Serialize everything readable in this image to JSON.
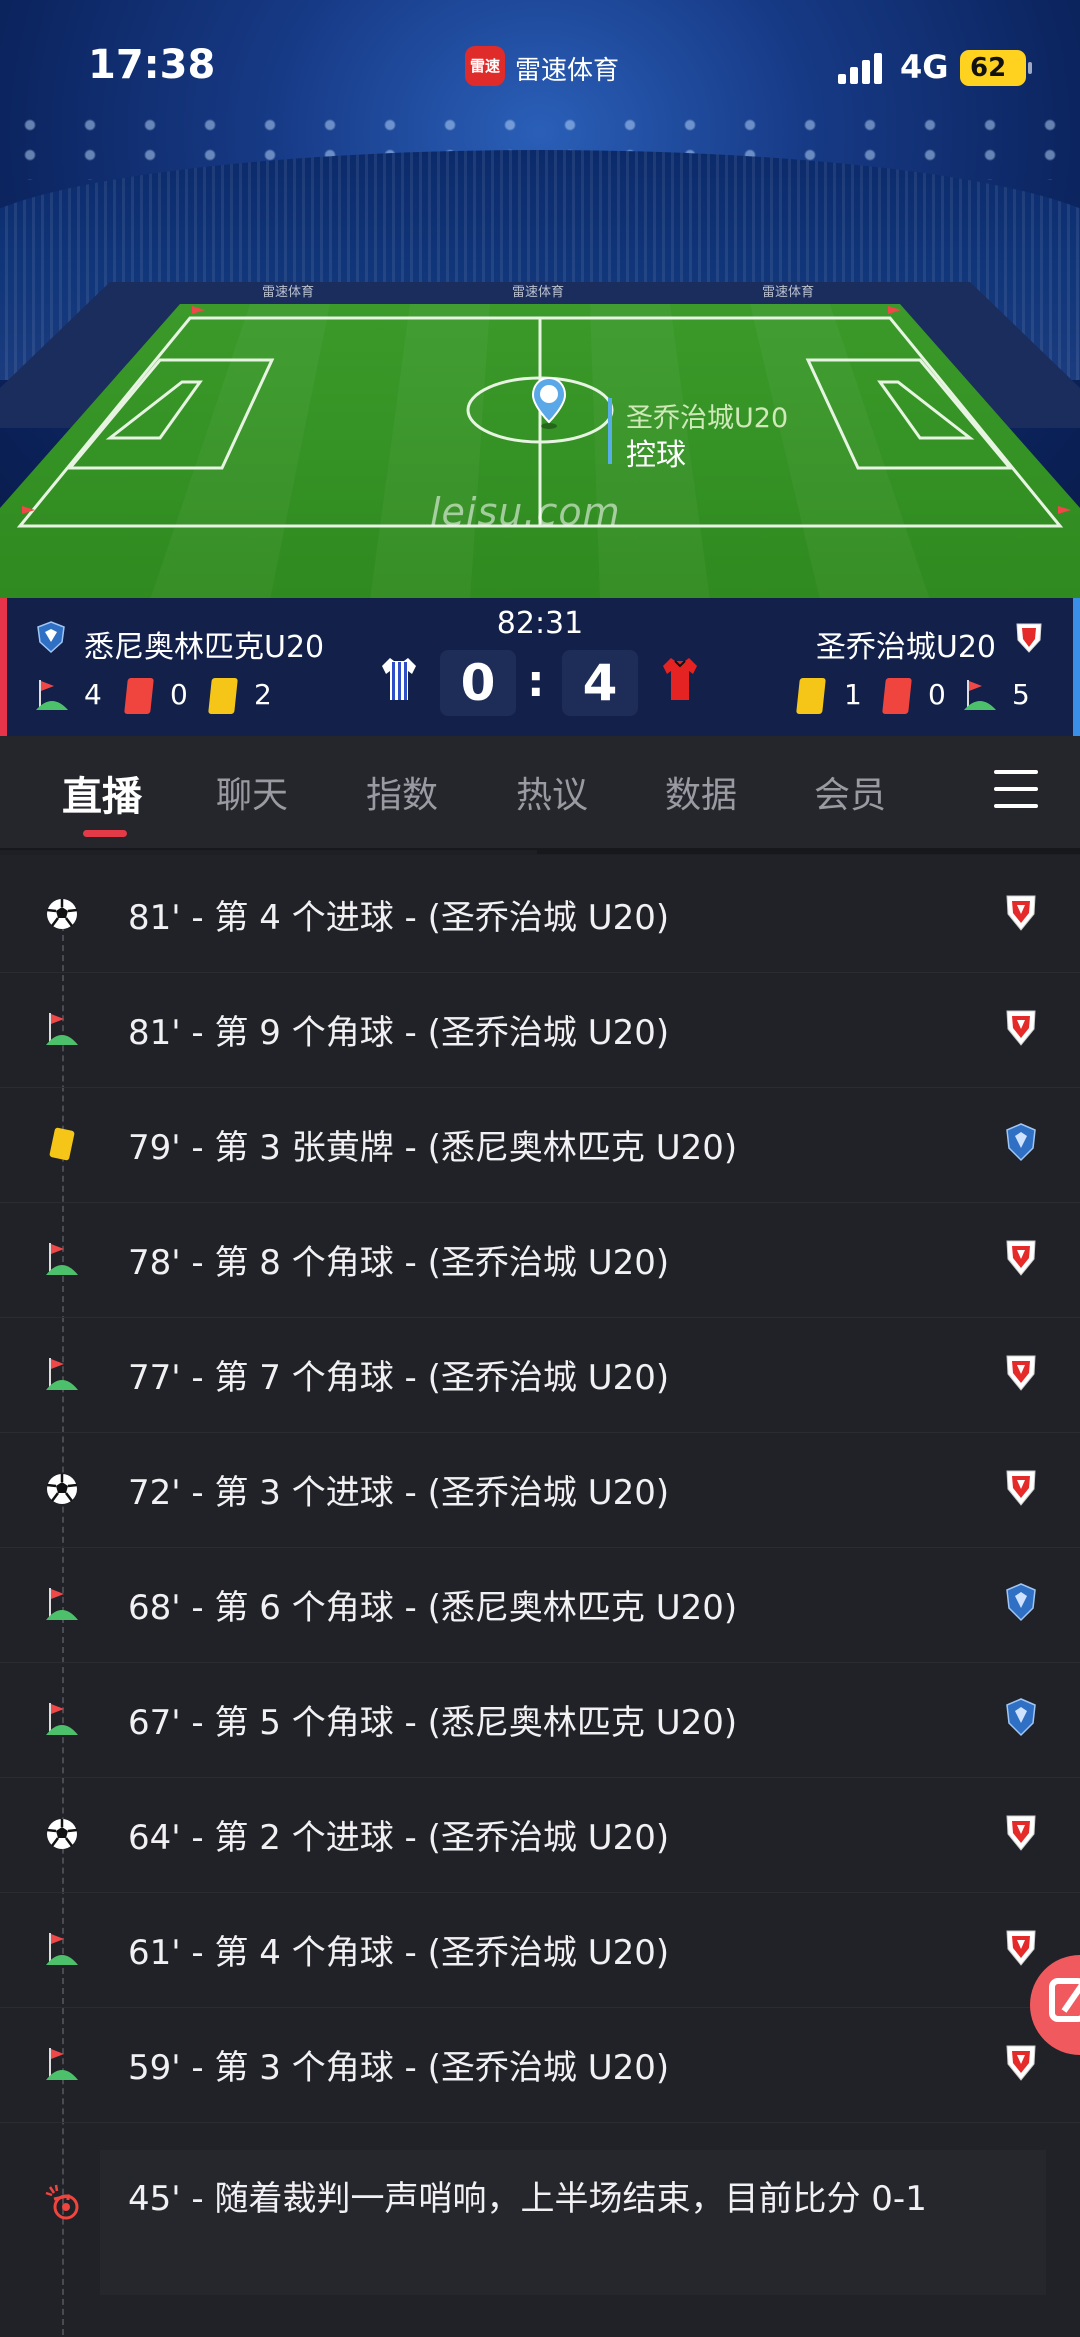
{
  "status_bar": {
    "time": "17:38",
    "app_badge": "雷速",
    "app_name": "雷速体育",
    "network": "4G",
    "battery": "62"
  },
  "pitch": {
    "possession_team": "圣乔治城U20",
    "possession_label": "控球",
    "watermark": "leisu.com"
  },
  "match": {
    "time": "82:31",
    "home": {
      "name": "悉尼奥林匹克U20",
      "score": "0",
      "corners": "4",
      "red_cards": "0",
      "yellow_cards": "2"
    },
    "away": {
      "name": "圣乔治城U20",
      "score": "4",
      "corners": "5",
      "red_cards": "0",
      "yellow_cards": "1"
    },
    "score_separator": ":"
  },
  "tabs": [
    {
      "label": "直播"
    },
    {
      "label": "聊天"
    },
    {
      "label": "指数"
    },
    {
      "label": "热议"
    },
    {
      "label": "数据"
    },
    {
      "label": "会员"
    }
  ],
  "events": [
    {
      "icon": "soccer-ball-icon",
      "text": "81' - 第 4 个进球 - (圣乔治城 U20)",
      "team": "away"
    },
    {
      "icon": "corner-flag-icon",
      "text": "81' - 第 9 个角球 - (圣乔治城 U20)",
      "team": "away"
    },
    {
      "icon": "yellow-card-icon",
      "text": "79' - 第 3 张黄牌 - (悉尼奥林匹克 U20)",
      "team": "home"
    },
    {
      "icon": "corner-flag-icon",
      "text": "78' - 第 8 个角球 - (圣乔治城 U20)",
      "team": "away"
    },
    {
      "icon": "corner-flag-icon",
      "text": "77' - 第 7 个角球 - (圣乔治城 U20)",
      "team": "away"
    },
    {
      "icon": "soccer-ball-icon",
      "text": "72' - 第 3 个进球 - (圣乔治城 U20)",
      "team": "away"
    },
    {
      "icon": "corner-flag-icon",
      "text": "68' - 第 6 个角球 - (悉尼奥林匹克 U20)",
      "team": "home"
    },
    {
      "icon": "corner-flag-icon",
      "text": "67' - 第 5 个角球 - (悉尼奥林匹克 U20)",
      "team": "home"
    },
    {
      "icon": "soccer-ball-icon",
      "text": "64' - 第 2 个进球 - (圣乔治城 U20)",
      "team": "away"
    },
    {
      "icon": "corner-flag-icon",
      "text": "61' - 第 4 个角球 - (圣乔治城 U20)",
      "team": "away"
    },
    {
      "icon": "corner-flag-icon",
      "text": "59' - 第 3 个角球 - (圣乔治城 U20)",
      "team": "away"
    }
  ],
  "half_time_event": {
    "icon": "whistle-icon",
    "text": "45' - 随着裁判一声哨响，上半场结束，目前比分 0-1"
  },
  "colors": {
    "accent_red": "#e23a47",
    "home_blue": "#3a8fe8",
    "card_yellow": "#f5c518",
    "card_red": "#f0443e"
  }
}
